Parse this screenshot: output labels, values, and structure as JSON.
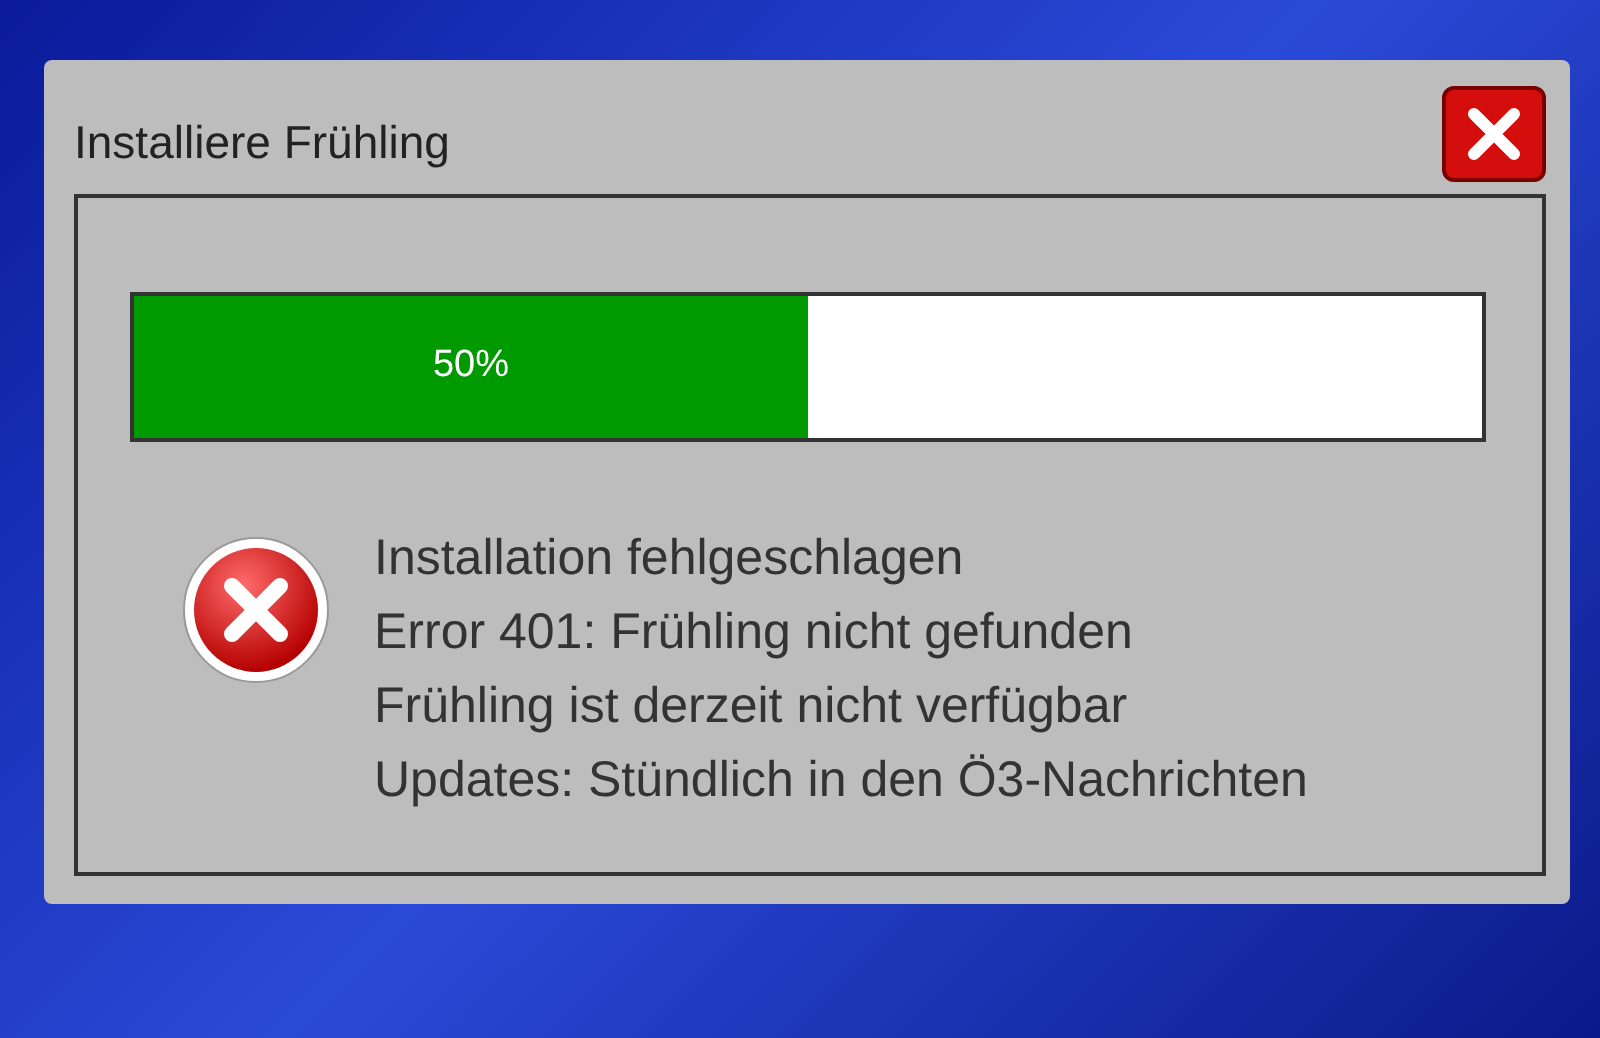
{
  "window": {
    "title": "Installiere Frühling"
  },
  "progress": {
    "level": 0.5,
    "reading": "50%"
  },
  "message": {
    "lines": [
      "Installation fehlgeschlagen",
      "Error 401: Frühling nicht gefunden",
      "Frühling ist derzeit nicht verfügbar",
      "Updates: Stündlich in den Ö3-Nachrichten"
    ]
  }
}
